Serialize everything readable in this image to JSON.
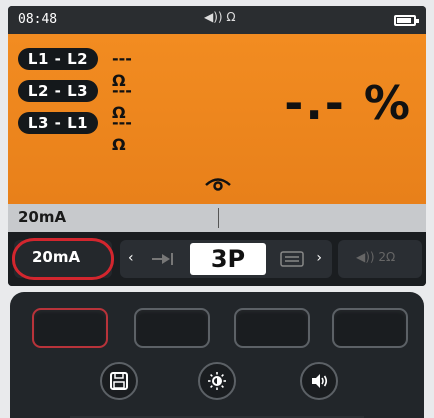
{
  "status": {
    "time": "08:48",
    "center_icon": "speaker-ohm-icon",
    "center_text": "◀)) Ω",
    "battery_icon": "battery-icon"
  },
  "measurement": {
    "rows": [
      {
        "phase": "L1 - L2",
        "value": "---Ω"
      },
      {
        "phase": "L2 - L3",
        "value": "---Ω"
      },
      {
        "phase": "L3 - L1",
        "value": "---Ω"
      }
    ],
    "result": "-.- %",
    "bottom_icon": "eye-icon"
  },
  "info": {
    "current": "20mA"
  },
  "softkeys": {
    "current_label": "20mA",
    "left_arrow": "‹",
    "right_arrow": "›",
    "mode": "3P",
    "buzzer_label": "◀)) 2Ω"
  },
  "colors": {
    "accent": "#f28c21",
    "highlight": "#d3262e"
  }
}
